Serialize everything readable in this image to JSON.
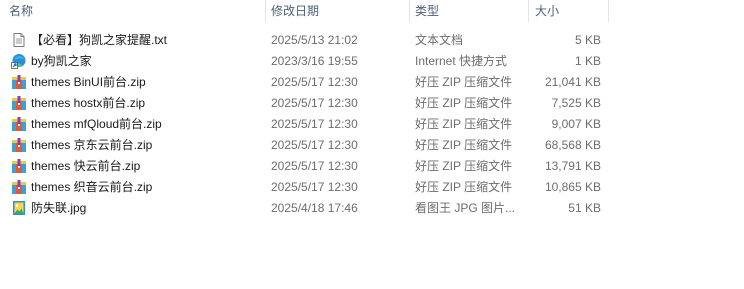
{
  "columns": {
    "name": "名称",
    "date": "修改日期",
    "type": "类型",
    "size": "大小"
  },
  "files": [
    {
      "icon": "text-file-icon",
      "name": "【必看】狗凯之家提醒.txt",
      "date": "2025/5/13 21:02",
      "type": "文本文档",
      "size": "5 KB"
    },
    {
      "icon": "internet-shortcut-icon",
      "name": "by狗凯之家",
      "date": "2023/3/16 19:55",
      "type": "Internet 快捷方式",
      "size": "1 KB"
    },
    {
      "icon": "zip-archive-icon",
      "name": "themes BinUI前台.zip",
      "date": "2025/5/17 12:30",
      "type": "好压 ZIP 压缩文件",
      "size": "21,041 KB"
    },
    {
      "icon": "zip-archive-icon",
      "name": "themes hostx前台.zip",
      "date": "2025/5/17 12:30",
      "type": "好压 ZIP 压缩文件",
      "size": "7,525 KB"
    },
    {
      "icon": "zip-archive-icon",
      "name": "themes mfQloud前台.zip",
      "date": "2025/5/17 12:30",
      "type": "好压 ZIP 压缩文件",
      "size": "9,007 KB"
    },
    {
      "icon": "zip-archive-icon",
      "name": "themes 京东云前台.zip",
      "date": "2025/5/17 12:30",
      "type": "好压 ZIP 压缩文件",
      "size": "68,568 KB"
    },
    {
      "icon": "zip-archive-icon",
      "name": "themes 快云前台.zip",
      "date": "2025/5/17 12:30",
      "type": "好压 ZIP 压缩文件",
      "size": "13,791 KB"
    },
    {
      "icon": "zip-archive-icon",
      "name": "themes 织音云前台.zip",
      "date": "2025/5/17 12:30",
      "type": "好压 ZIP 压缩文件",
      "size": "10,865 KB"
    },
    {
      "icon": "image-file-icon",
      "name": "防失联.jpg",
      "date": "2025/4/18 17:46",
      "type": "看图王 JPG 图片...",
      "size": "51 KB"
    }
  ]
}
